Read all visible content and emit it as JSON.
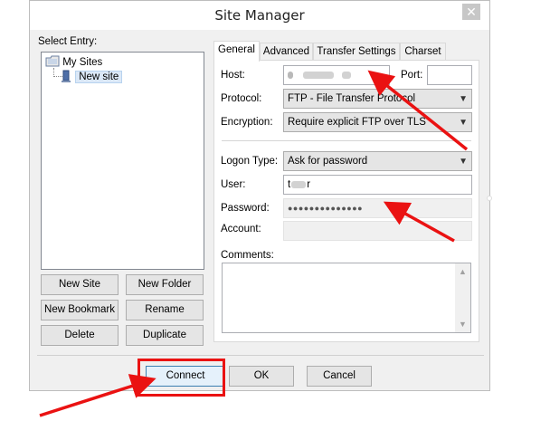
{
  "window": {
    "title": "Site Manager",
    "close_glyph": "✕"
  },
  "entries": {
    "label": "Select Entry:",
    "root": "My Sites",
    "child": "New site"
  },
  "left_buttons": {
    "new_site": "New Site",
    "new_folder": "New Folder",
    "new_bookmark": "New Bookmark",
    "rename": "Rename",
    "delete": "Delete",
    "duplicate": "Duplicate"
  },
  "tabs": [
    "General",
    "Advanced",
    "Transfer Settings",
    "Charset"
  ],
  "general": {
    "host_label": "Host:",
    "host_value": "",
    "port_label": "Port:",
    "port_value": "",
    "protocol_label": "Protocol:",
    "protocol_value": "FTP - File Transfer Protocol",
    "encryption_label": "Encryption:",
    "encryption_value": "Require explicit FTP over TLS",
    "logon_label": "Logon Type:",
    "logon_value": "Ask for password",
    "user_label": "User:",
    "user_value": "t",
    "user_value_tail": "r",
    "password_label": "Password:",
    "password_value": "●●●●●●●●●●●●●●",
    "account_label": "Account:",
    "comments_label": "Comments:"
  },
  "footer": {
    "connect": "Connect",
    "ok": "OK",
    "cancel": "Cancel"
  },
  "colors": {
    "annotation": "#ea1212",
    "accent": "#3c7fb1"
  }
}
